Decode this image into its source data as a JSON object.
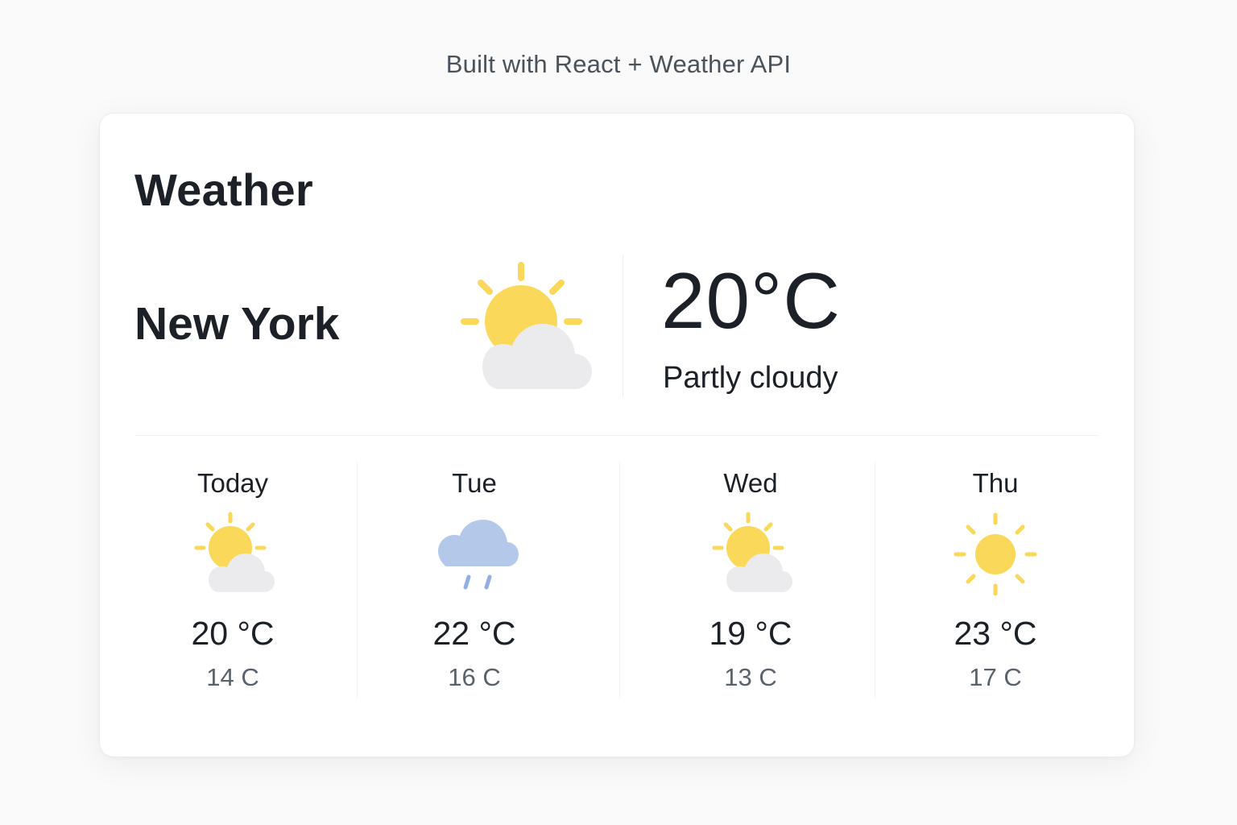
{
  "caption": "Built with React + Weather API",
  "card": {
    "title": "Weather",
    "city": "New York",
    "current": {
      "icon": "partly-cloudy-icon",
      "temperature": "20°C",
      "condition": "Partly cloudy"
    },
    "forecast": [
      {
        "day": "Today",
        "icon": "partly-cloudy-icon",
        "high": "20 °C",
        "low": "14 C"
      },
      {
        "day": "Tue",
        "icon": "rain-cloud-icon",
        "high": "22 °C",
        "low": "16 C"
      },
      {
        "day": "Wed",
        "icon": "partly-cloudy-icon",
        "high": "19 °C",
        "low": "13 C"
      },
      {
        "day": "Thu",
        "icon": "sun-icon",
        "high": "23 °C",
        "low": "17 C"
      }
    ]
  },
  "colors": {
    "sun": "#f9d85a",
    "cloud": "#ebebed",
    "rain_cloud": "#b4c8ea",
    "rain_drop": "#93aee2"
  }
}
